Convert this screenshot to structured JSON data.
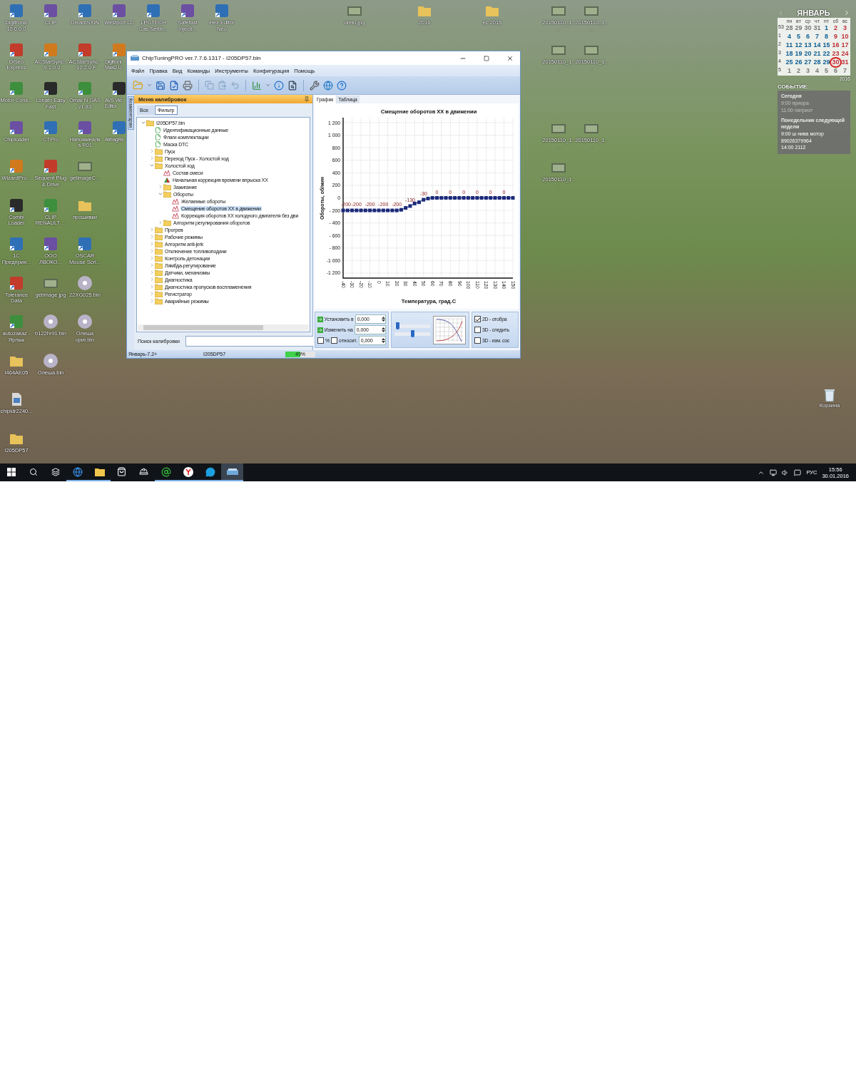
{
  "desktop_icons": {
    "columns": [
      [
        {
          "label": "Digitronic 10.0.0.0",
          "kind": "app"
        },
        {
          "label": "DiSeo Express",
          "kind": "app"
        },
        {
          "label": "Motor Cons...",
          "kind": "app"
        },
        {
          "label": "Chiploader",
          "kind": "app"
        },
        {
          "label": "WizardPro...",
          "kind": "app"
        },
        {
          "label": "Combi Loader",
          "kind": "app"
        },
        {
          "label": "1С Предприя...",
          "kind": "app"
        },
        {
          "label": "Tolerance Data",
          "kind": "app"
        },
        {
          "label": "autozakaz - Ярлык",
          "kind": "app"
        },
        {
          "label": "I464AE05",
          "kind": "folder"
        },
        {
          "label": "chipldr2240...",
          "kind": "file"
        },
        {
          "label": "I205DP57",
          "kind": "folder"
        }
      ],
      [
        {
          "label": "CLIP",
          "kind": "app"
        },
        {
          "label": "ACStarSync... 9.1.0.0",
          "kind": "app"
        },
        {
          "label": "Lonato Easy Fast",
          "kind": "app"
        },
        {
          "label": "CTPro",
          "kind": "app"
        },
        {
          "label": "Sequent Plug & Drive",
          "kind": "app"
        },
        {
          "label": "CLIP RENAULT ...",
          "kind": "app"
        },
        {
          "label": "ООО ЛВОКО...",
          "kind": "app"
        },
        {
          "label": "getimage.jpg",
          "kind": "image"
        },
        {
          "label": "b122hr91.bin",
          "kind": "disc"
        },
        {
          "label": "Олеша.bin",
          "kind": "disc"
        }
      ],
      [
        {
          "label": "DreamSXIN",
          "kind": "app"
        },
        {
          "label": "ACStarSync... 10.2.0.F",
          "kind": "app"
        },
        {
          "label": "Omar N GAS v1.83",
          "kind": "app"
        },
        {
          "label": "Напоминалка R01",
          "kind": "app"
        },
        {
          "label": "getimageC...",
          "kind": "image"
        },
        {
          "label": "прошивки",
          "kind": "folder"
        },
        {
          "label": "OSCAR Mouse Scri...",
          "kind": "app"
        },
        {
          "label": "22XG025.bin",
          "kind": "disc"
        },
        {
          "label": "Олеша ориг.bin",
          "kind": "disc"
        }
      ],
      [
        {
          "label": "Westport LD",
          "kind": "app"
        },
        {
          "label": "Digitroni Maxi2 U",
          "kind": "app"
        },
        {
          "label": "AVS Vid Editor",
          "kind": "app"
        },
        {
          "label": "AirbagRe",
          "kind": "app"
        }
      ],
      [
        {
          "label": "LPGTECH Gas Settin...",
          "kind": "app"
        }
      ],
      [
        {
          "label": "Safefast Injecti...",
          "kind": "app"
        }
      ],
      [
        {
          "label": "Hex Editor Neo",
          "kind": "app"
        }
      ]
    ]
  },
  "desktop_files": [
    {
      "label": "опно.jpg",
      "kind": "image"
    },
    {
      "label": "2016",
      "kind": "folder"
    },
    {
      "label": "ес 2015",
      "kind": "folder"
    },
    {
      "label": "20150110_1...",
      "kind": "image"
    },
    {
      "label": "20150110_1...",
      "kind": "image"
    },
    {
      "label": "20150110_1...",
      "kind": "image"
    },
    {
      "label": "20150110_1...",
      "kind": "image"
    },
    {
      "label": "20150110_1...",
      "kind": "image"
    },
    {
      "label": "20150110_1...",
      "kind": "image"
    },
    {
      "label": "20150110_1...",
      "kind": "image"
    }
  ],
  "recycle_bin": {
    "label": "Корзина"
  },
  "calendar": {
    "month": "ЯНВАРЬ",
    "year": "2016",
    "weekdays": [
      "пн",
      "вт",
      "ср",
      "чт",
      "пт",
      "сб",
      "вс"
    ],
    "weeks": [
      {
        "number": "53",
        "days": [
          {
            "day": "28",
            "in_month": false,
            "today": false
          },
          {
            "day": "29",
            "in_month": false,
            "today": false
          },
          {
            "day": "30",
            "in_month": false,
            "today": false
          },
          {
            "day": "31",
            "in_month": false,
            "today": false
          },
          {
            "day": "1",
            "in_month": true,
            "today": false
          },
          {
            "day": "2",
            "in_month": true,
            "today": false
          },
          {
            "day": "3",
            "in_month": true,
            "today": false
          }
        ]
      },
      {
        "number": "1",
        "days": [
          {
            "day": "4",
            "in_month": true,
            "today": false
          },
          {
            "day": "5",
            "in_month": true,
            "today": false
          },
          {
            "day": "6",
            "in_month": true,
            "today": false
          },
          {
            "day": "7",
            "in_month": true,
            "today": false
          },
          {
            "day": "8",
            "in_month": true,
            "today": false
          },
          {
            "day": "9",
            "in_month": true,
            "today": false
          },
          {
            "day": "10",
            "in_month": true,
            "today": false
          }
        ]
      },
      {
        "number": "2",
        "days": [
          {
            "day": "11",
            "in_month": true,
            "today": false
          },
          {
            "day": "12",
            "in_month": true,
            "today": false
          },
          {
            "day": "13",
            "in_month": true,
            "today": false
          },
          {
            "day": "14",
            "in_month": true,
            "today": false
          },
          {
            "day": "15",
            "in_month": true,
            "today": false
          },
          {
            "day": "16",
            "in_month": true,
            "today": false
          },
          {
            "day": "17",
            "in_month": true,
            "today": false
          }
        ]
      },
      {
        "number": "3",
        "days": [
          {
            "day": "18",
            "in_month": true,
            "today": false
          },
          {
            "day": "19",
            "in_month": true,
            "today": false
          },
          {
            "day": "20",
            "in_month": true,
            "today": false
          },
          {
            "day": "21",
            "in_month": true,
            "today": false
          },
          {
            "day": "22",
            "in_month": true,
            "today": false
          },
          {
            "day": "23",
            "in_month": true,
            "today": false
          },
          {
            "day": "24",
            "in_month": true,
            "today": false
          }
        ]
      },
      {
        "number": "4",
        "days": [
          {
            "day": "25",
            "in_month": true,
            "today": false
          },
          {
            "day": "26",
            "in_month": true,
            "today": false
          },
          {
            "day": "27",
            "in_month": true,
            "today": false
          },
          {
            "day": "28",
            "in_month": true,
            "today": false
          },
          {
            "day": "29",
            "in_month": true,
            "today": false
          },
          {
            "day": "30",
            "in_month": true,
            "today": true
          },
          {
            "day": "31",
            "in_month": true,
            "today": false
          }
        ]
      },
      {
        "number": "5",
        "days": [
          {
            "day": "1",
            "in_month": false,
            "today": false
          },
          {
            "day": "2",
            "in_month": false,
            "today": false
          },
          {
            "day": "3",
            "in_month": false,
            "today": false
          },
          {
            "day": "4",
            "in_month": false,
            "today": false
          },
          {
            "day": "5",
            "in_month": false,
            "today": false
          },
          {
            "day": "6",
            "in_month": false,
            "today": false
          },
          {
            "day": "7",
            "in_month": false,
            "today": false
          }
        ]
      }
    ],
    "events_title": "СОБЫТИЕ:",
    "event_groups": [
      {
        "heading": "Сегодня",
        "past": true,
        "lines": [
          "9:00 приора",
          "11:00 патриот"
        ]
      },
      {
        "heading": "Понедельник следующей недели",
        "past": false,
        "lines": [
          "9:00 ш нива мотор",
          "89026379964",
          "14:00 2112"
        ]
      }
    ]
  },
  "window": {
    "title": "ChipTuningPRO ver.7.7.6.1317 - I205DP57.bin",
    "menu": [
      "Файл",
      "Правка",
      "Вид",
      "Команды",
      "Инструменты",
      "Конфигурация",
      "Помощь"
    ],
    "side_tab": "Комментарии",
    "calibrations": {
      "title": "Меню калибровок",
      "tabs": [
        {
          "label": "Все",
          "selected": false
        },
        {
          "label": "Фильтр",
          "selected": true
        }
      ],
      "tree": [
        {
          "label": "I205DP57.bin",
          "kind": "folder",
          "selected": false,
          "expanded": true,
          "children": [
            {
              "label": "Идентификационные данные",
              "kind": "check",
              "selected": false
            },
            {
              "label": "Флаги комплектации",
              "kind": "check",
              "selected": false
            },
            {
              "label": "Маска DTC",
              "kind": "check",
              "selected": false
            },
            {
              "label": "Пуск",
              "kind": "folder",
              "selected": false,
              "expanded": false
            },
            {
              "label": "Переход Пуск - Холостой ход",
              "kind": "folder",
              "selected": false,
              "expanded": false
            },
            {
              "label": "Холостой ход",
              "kind": "folder",
              "selected": false,
              "expanded": true,
              "children": [
                {
                  "label": "Состав смеси",
                  "kind": "map",
                  "selected": false
                },
                {
                  "label": "Начальная коррекция времени впрыска ХХ",
                  "kind": "surface",
                  "selected": false
                },
                {
                  "label": "Зажигание",
                  "kind": "folder",
                  "selected": false,
                  "expanded": false
                },
                {
                  "label": "Обороты",
                  "kind": "folder",
                  "selected": false,
                  "expanded": true,
                  "children": [
                    {
                      "label": "Желаемые обороты",
                      "kind": "map",
                      "selected": false
                    },
                    {
                      "label": "Смещение оборотов ХХ в движении",
                      "kind": "map",
                      "selected": true
                    },
                    {
                      "label": "Коррекция оборотов ХХ холодного двигателя без дви",
                      "kind": "map",
                      "selected": false
                    }
                  ]
                },
                {
                  "label": "Алгоритм регулирования оборотов",
                  "kind": "folder",
                  "selected": false,
                  "expanded": false
                }
              ]
            },
            {
              "label": "Прогрев",
              "kind": "folder",
              "selected": false,
              "expanded": false
            },
            {
              "label": "Рабочие режимы",
              "kind": "folder",
              "selected": false,
              "expanded": false
            },
            {
              "label": "Алгоритм anti-jerk",
              "kind": "folder",
              "selected": false,
              "expanded": false
            },
            {
              "label": "Отключение топливоподачи",
              "kind": "folder",
              "selected": false,
              "expanded": false
            },
            {
              "label": "Контроль детонации",
              "kind": "folder",
              "selected": false,
              "expanded": false
            },
            {
              "label": "Лямбда-регулирование",
              "kind": "folder",
              "selected": false,
              "expanded": false
            },
            {
              "label": "Датчики, механизмы",
              "kind": "folder",
              "selected": false,
              "expanded": false
            },
            {
              "label": "Диагностика",
              "kind": "folder",
              "selected": false,
              "expanded": false
            },
            {
              "label": "Диагностика пропусков воспламенения",
              "kind": "folder",
              "selected": false,
              "expanded": false
            },
            {
              "label": "Регистратор",
              "kind": "folder",
              "selected": false,
              "expanded": false
            },
            {
              "label": "Аварийные режимы",
              "kind": "folder",
              "selected": false,
              "expanded": false
            }
          ]
        }
      ],
      "search_label": "Поиск калибровки"
    },
    "view_tabs": [
      {
        "label": "График",
        "selected": true
      },
      {
        "label": "Таблица",
        "selected": false
      }
    ],
    "chart_data": {
      "type": "line",
      "title": "Смещение оборотов ХХ в движении",
      "xlabel": "Температура, град.С",
      "ylabel": "Обороты, об/мин",
      "x": [
        -40,
        -35,
        -30,
        -25,
        -20,
        -15,
        -10,
        -5,
        0,
        5,
        10,
        15,
        20,
        25,
        30,
        35,
        40,
        45,
        50,
        55,
        60,
        65,
        70,
        75,
        80,
        85,
        90,
        95,
        100,
        105,
        110,
        115,
        120,
        125,
        130,
        135,
        140,
        145,
        150
      ],
      "grid": true,
      "series": [
        {
          "color": "#1c2a7a",
          "marker": "square",
          "values": [
            -200,
            -200,
            -200,
            -200,
            -200,
            -200,
            -200,
            -200,
            -200,
            -200,
            -200,
            -200,
            -200,
            -190,
            -160,
            -130,
            -90,
            -70,
            -30,
            -10,
            0,
            0,
            0,
            0,
            0,
            0,
            0,
            0,
            0,
            0,
            0,
            0,
            0,
            0,
            0,
            0,
            0,
            0,
            0
          ]
        }
      ],
      "value_labels": [
        "-200",
        null,
        null,
        "-200",
        null,
        null,
        "-200",
        null,
        null,
        "-200",
        null,
        null,
        "-200",
        null,
        null,
        "-130",
        null,
        null,
        "-30",
        null,
        null,
        "0",
        null,
        null,
        "0",
        null,
        null,
        "0",
        null,
        null,
        "0",
        null,
        null,
        "0",
        null,
        null,
        "0",
        null,
        null
      ],
      "xlim": [
        -40,
        150
      ],
      "ylim": [
        -1280,
        1280
      ],
      "xticks": [
        -40,
        -30,
        -20,
        -10,
        0,
        10,
        20,
        30,
        40,
        50,
        60,
        70,
        80,
        90,
        100,
        110,
        120,
        130,
        140,
        150
      ],
      "yticks": [
        {
          "value": 1200,
          "label": "1 200"
        },
        {
          "value": 1000,
          "label": "1 000"
        },
        {
          "value": 800,
          "label": "800"
        },
        {
          "value": 600,
          "label": "600"
        },
        {
          "value": 400,
          "label": "400"
        },
        {
          "value": 200,
          "label": "200"
        },
        {
          "value": 0,
          "label": "0"
        },
        {
          "value": -200,
          "label": "- 200"
        },
        {
          "value": -400,
          "label": "- 400"
        },
        {
          "value": -600,
          "label": "- 600"
        },
        {
          "value": -800,
          "label": "- 800"
        },
        {
          "value": -1000,
          "label": "-1 000"
        },
        {
          "value": -1200,
          "label": "-1 200"
        }
      ]
    },
    "controls": {
      "set_label": "Установить в",
      "set_value": "0,000",
      "change_label": "Изменить на",
      "change_value": "0,000",
      "percent_label": "%",
      "percent_checked": false,
      "relative_label": "относит.",
      "relative_checked": false,
      "relative_value": "0,000",
      "sliders": [
        {
          "level": 0.05
        },
        {
          "level": 0.5
        }
      ],
      "options": [
        {
          "label": "2D - отобра",
          "checked": true
        },
        {
          "label": "3D - следить",
          "checked": false
        },
        {
          "label": "3D - изм. сос",
          "checked": false
        }
      ]
    },
    "status_bar": {
      "profile": "Январь-7.2+",
      "file": "I205DP57",
      "progress": {
        "level": 0.49,
        "reading": "49%"
      }
    }
  },
  "taskbar": {
    "apps": [
      {
        "kind": "browser",
        "running": true,
        "selected": false
      },
      {
        "kind": "explorer",
        "running": true,
        "selected": false
      },
      {
        "kind": "store",
        "running": false,
        "selected": false
      },
      {
        "kind": "helmet",
        "running": false,
        "selected": false
      },
      {
        "kind": "messenger",
        "running": true,
        "selected": false
      },
      {
        "kind": "round",
        "running": true,
        "selected": false
      },
      {
        "kind": "chat",
        "running": true,
        "selected": false
      },
      {
        "kind": "tuner",
        "running": true,
        "selected": true
      }
    ],
    "language": "РУС",
    "time": "15:56",
    "date": "30.01.2016"
  }
}
